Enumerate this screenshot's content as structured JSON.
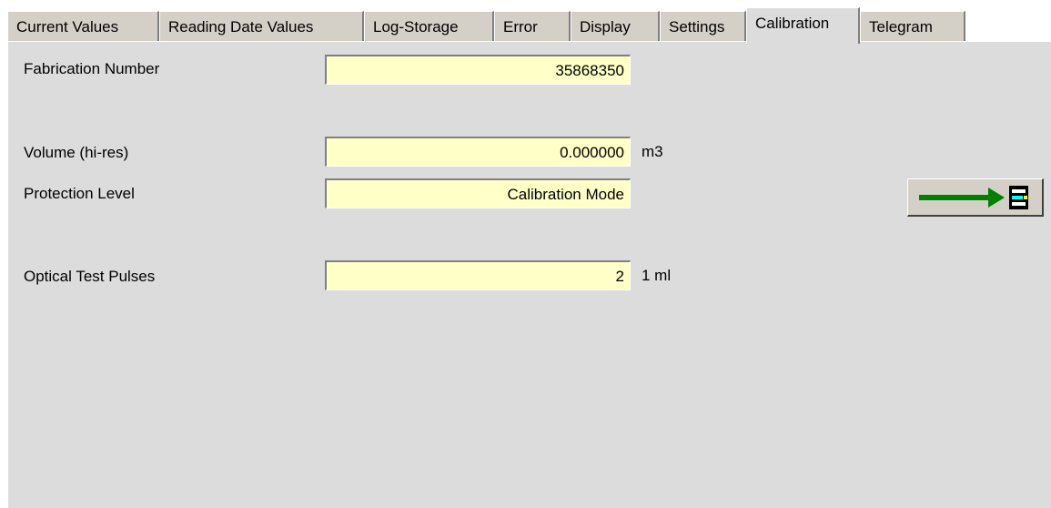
{
  "tabs": [
    {
      "label": "Current Values"
    },
    {
      "label": "Reading Date Values"
    },
    {
      "label": "Log-Storage"
    },
    {
      "label": "Error"
    },
    {
      "label": "Display"
    },
    {
      "label": "Settings"
    },
    {
      "label": "Calibration"
    },
    {
      "label": "Telegram"
    }
  ],
  "active_tab": "Calibration",
  "fields": {
    "fabrication_number": {
      "label": "Fabrication Number",
      "value": "35868350"
    },
    "volume_hires": {
      "label": "Volume (hi-res)",
      "value": "0.000000",
      "unit": "m3"
    },
    "protection_level": {
      "label": "Protection Level",
      "value": "Calibration Mode"
    },
    "optical_test_pulses": {
      "label": "Optical Test Pulses",
      "value": "2",
      "unit": "1 ml"
    }
  },
  "action_button": {
    "icon": "arrow-to-device-icon",
    "arrow_color": "#008000"
  },
  "colors": {
    "panel_bg": "#dcdcdc",
    "field_bg": "#ffffc8",
    "tab_bg": "#d4d0c8"
  }
}
